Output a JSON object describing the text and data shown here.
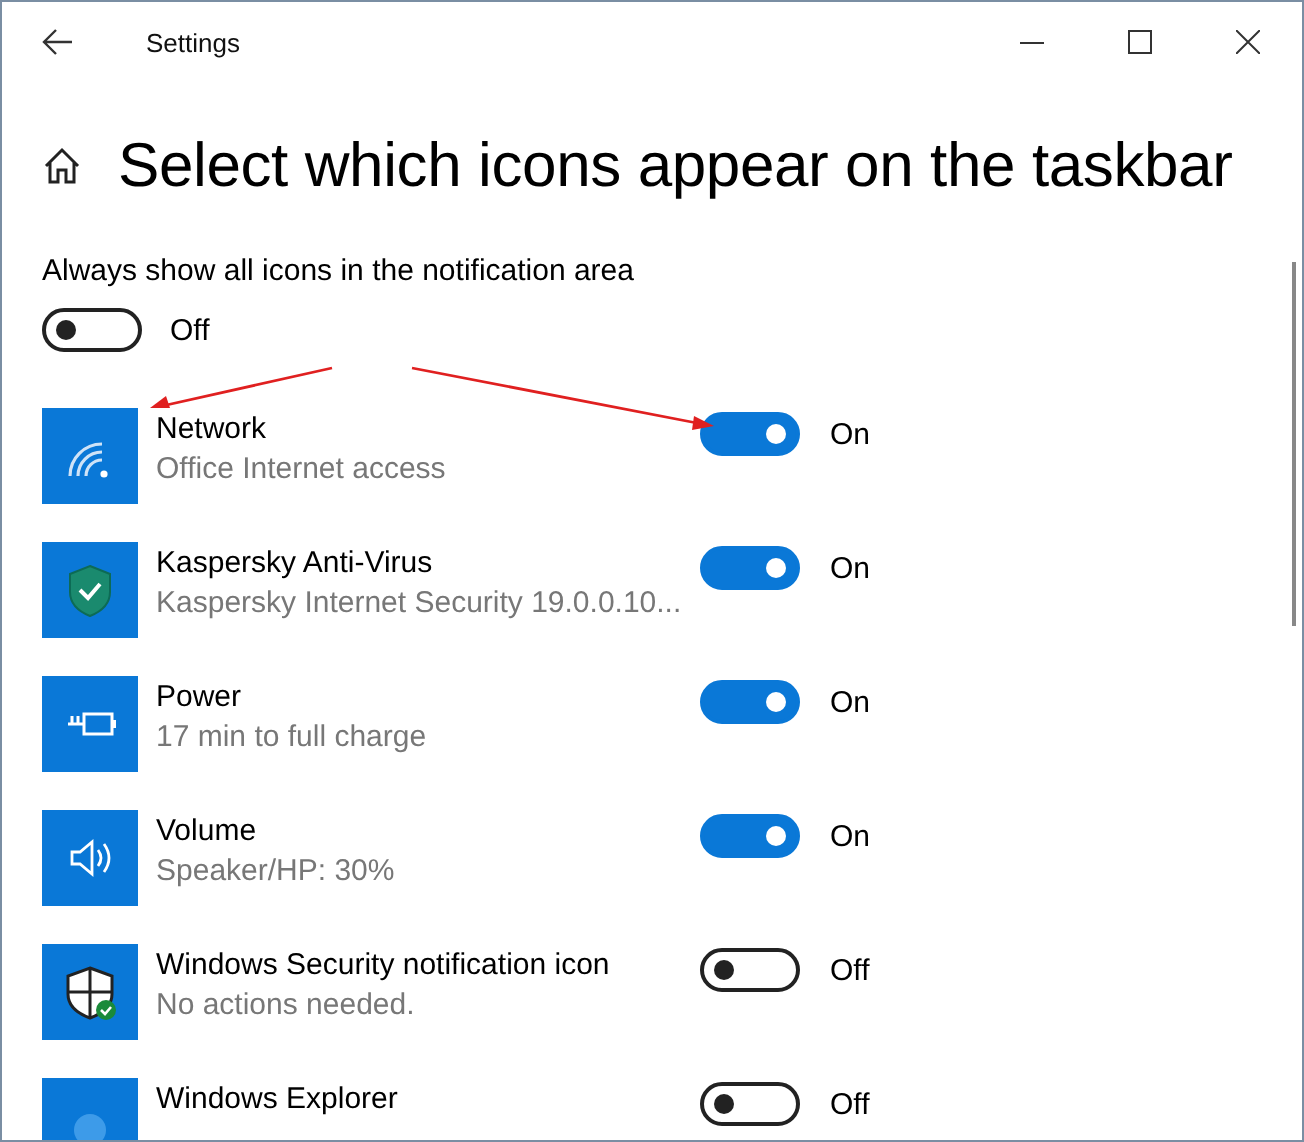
{
  "window": {
    "title": "Settings"
  },
  "page": {
    "title": "Select which icons appear on the taskbar"
  },
  "always_show": {
    "label": "Always show all icons in the notification area",
    "on": false,
    "state_label": "Off"
  },
  "items": [
    {
      "name": "Network",
      "detail": "Office Internet access",
      "on": true,
      "state_label": "On"
    },
    {
      "name": "Kaspersky Anti-Virus",
      "detail": "Kaspersky Internet Security 19.0.0.10...",
      "on": true,
      "state_label": "On"
    },
    {
      "name": "Power",
      "detail": "17 min to full charge",
      "on": true,
      "state_label": "On"
    },
    {
      "name": "Volume",
      "detail": "Speaker/HP: 30%",
      "on": true,
      "state_label": "On"
    },
    {
      "name": "Windows Security notification icon",
      "detail": "No actions needed.",
      "on": false,
      "state_label": "Off"
    },
    {
      "name": "Windows Explorer",
      "on": false,
      "state_label": "Off"
    }
  ]
}
